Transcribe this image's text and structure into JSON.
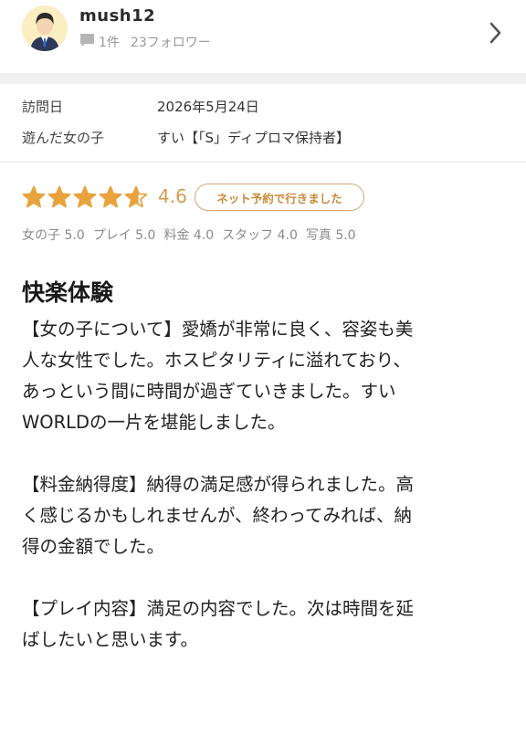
{
  "user": {
    "name": "mush12",
    "review_count": "1件",
    "followers": "23フォロワー"
  },
  "visit": {
    "date_label": "訪問日",
    "date_value": "2026年5月24日",
    "girl_label": "遊んだ女の子",
    "girl_value": "すい【「S」ディプロマ保持者】"
  },
  "rating": {
    "score": "4.6",
    "stars": 4.6,
    "badge": "ネット予約で行きました",
    "sub_scores": [
      "女の子 5.0",
      "プレイ 5.0",
      "料金 4.0",
      "スタッフ 4.0",
      "写真 5.0"
    ]
  },
  "review": {
    "title": "快楽体験",
    "paragraphs": [
      "【女の子について】愛嬌が非常に良く、容姿も美\n人な女性でした。ホスピタリティに溢れており、\nあっという間に時間が過ぎていきました。すい\nWORLDの一片を堪能しました。",
      "【料金納得度】納得の満足感が得られました。高\nく感じるかもしれませんが、終わってみれば、納\n得の金額でした。",
      "【プレイ内容】満足の内容でした。次は時間を延\nばしたいと思います。"
    ]
  },
  "colors": {
    "star": "#e8a33d",
    "badge": "#c98a3a",
    "band": "#f0f0f0"
  },
  "icons": {
    "avatar": "avatar-icon",
    "review_count": "comment-icon",
    "navigate": "chevron-right-icon"
  }
}
